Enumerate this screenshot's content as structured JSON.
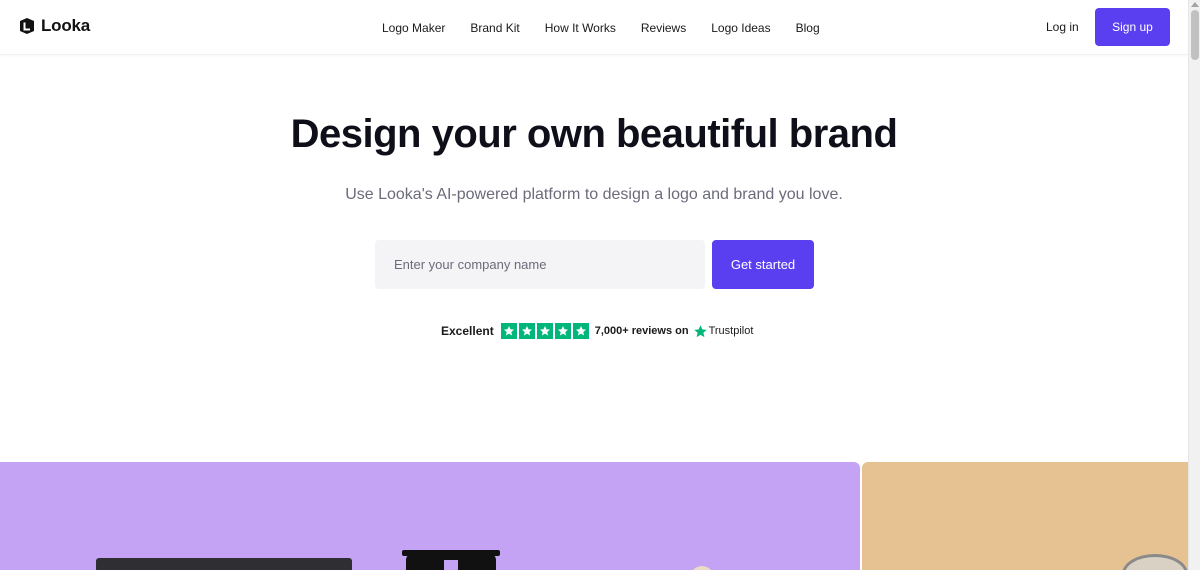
{
  "brand": {
    "name": "Looka"
  },
  "nav": {
    "items": [
      {
        "label": "Logo Maker"
      },
      {
        "label": "Brand Kit"
      },
      {
        "label": "How It Works"
      },
      {
        "label": "Reviews"
      },
      {
        "label": "Logo Ideas"
      },
      {
        "label": "Blog"
      }
    ],
    "login_label": "Log in",
    "signup_label": "Sign up"
  },
  "hero": {
    "title": "Design your own beautiful brand",
    "subtitle": "Use Looka's AI-powered platform to design a logo and brand you love.",
    "input_placeholder": "Enter your company name",
    "input_value": "",
    "cta_label": "Get started"
  },
  "trustpilot": {
    "rating_label": "Excellent",
    "stars": 5,
    "reviews_label": "7,000+ reviews on",
    "platform": "Trustpilot",
    "icon": "star-icon"
  },
  "colors": {
    "accent": "#5a3ff0",
    "trustpilot_green": "#00b67a",
    "card_purple": "#c4a2f4",
    "card_tan": "#e6c191"
  }
}
